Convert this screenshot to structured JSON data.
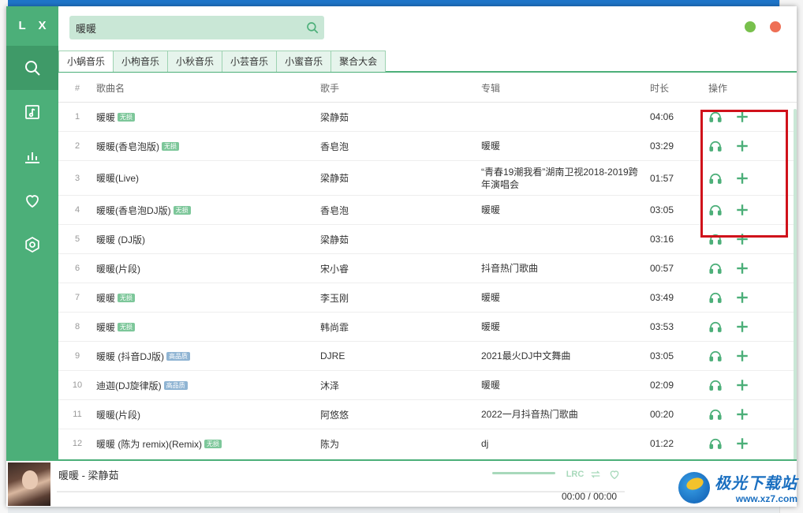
{
  "app": {
    "logo": "L X"
  },
  "sidebar": {
    "items": [
      {
        "icon": "search-icon",
        "active": true
      },
      {
        "icon": "music-list-icon",
        "active": false
      },
      {
        "icon": "chart-icon",
        "active": false
      },
      {
        "icon": "heart-icon",
        "active": false
      },
      {
        "icon": "settings-icon",
        "active": false
      }
    ]
  },
  "search": {
    "value": "暖暖",
    "placeholder": ""
  },
  "tabs": [
    "小蜗音乐",
    "小枸音乐",
    "小秋音乐",
    "小芸音乐",
    "小蜜音乐",
    "聚合大会"
  ],
  "table": {
    "headers": {
      "num": "#",
      "name": "歌曲名",
      "singer": "歌手",
      "album": "专辑",
      "time": "时长",
      "ops": "操作"
    },
    "rows": [
      {
        "num": "1",
        "name": "暖暖",
        "badge": "无损",
        "badge_type": "lossless",
        "singer": "梁静茹",
        "album": "",
        "time": "04:06"
      },
      {
        "num": "2",
        "name": "暖暖(香皂泡版)",
        "badge": "无损",
        "badge_type": "lossless",
        "singer": "香皂泡",
        "album": "暖暖",
        "time": "03:29"
      },
      {
        "num": "3",
        "name": "暖暖(Live)",
        "badge": "",
        "badge_type": "",
        "singer": "梁静茹",
        "album": "“青春19潮我看”湖南卫视2018-2019跨年演唱会",
        "time": "01:57"
      },
      {
        "num": "4",
        "name": "暖暖(香皂泡DJ版)",
        "badge": "无损",
        "badge_type": "lossless",
        "singer": "香皂泡",
        "album": "暖暖",
        "time": "03:05"
      },
      {
        "num": "5",
        "name": "暖暖 (DJ版)",
        "badge": "",
        "badge_type": "",
        "singer": "梁静茹",
        "album": "",
        "time": "03:16"
      },
      {
        "num": "6",
        "name": "暖暖(片段)",
        "badge": "",
        "badge_type": "",
        "singer": "宋小睿",
        "album": "抖音热门歌曲",
        "time": "00:57"
      },
      {
        "num": "7",
        "name": "暖暖",
        "badge": "无损",
        "badge_type": "lossless",
        "singer": "李玉刚",
        "album": "暖暖",
        "time": "03:49"
      },
      {
        "num": "8",
        "name": "暖暖",
        "badge": "无损",
        "badge_type": "lossless",
        "singer": "韩尚霏",
        "album": "暖暖",
        "time": "03:53"
      },
      {
        "num": "9",
        "name": "暖暖 (抖音DJ版)",
        "badge": "高品质",
        "badge_type": "hq",
        "singer": "DJRE",
        "album": "2021最火DJ中文舞曲",
        "time": "03:05"
      },
      {
        "num": "10",
        "name": "迪迦(DJ旋律版)",
        "badge": "高品质",
        "badge_type": "hq",
        "singer": "沐泽",
        "album": "暖暖",
        "time": "02:09"
      },
      {
        "num": "11",
        "name": "暖暖(片段)",
        "badge": "",
        "badge_type": "",
        "singer": "阿悠悠",
        "album": "2022一月抖音热门歌曲",
        "time": "00:20"
      },
      {
        "num": "12",
        "name": "暖暖 (陈为 remix)(Remix)",
        "badge": "无损",
        "badge_type": "lossless",
        "singer": "陈为",
        "album": "dj",
        "time": "01:22"
      }
    ]
  },
  "player": {
    "title": "暖暖 - 梁静茹",
    "current": "00:00",
    "separator": "/",
    "total": "00:00",
    "lrc_label": "LRC"
  },
  "watermark": {
    "line1": "极光下载站",
    "line2": "www.xz7.com"
  },
  "colors": {
    "accent": "#4caf79",
    "accent_dark": "#3f9a68",
    "highlight": "#d0121b"
  }
}
